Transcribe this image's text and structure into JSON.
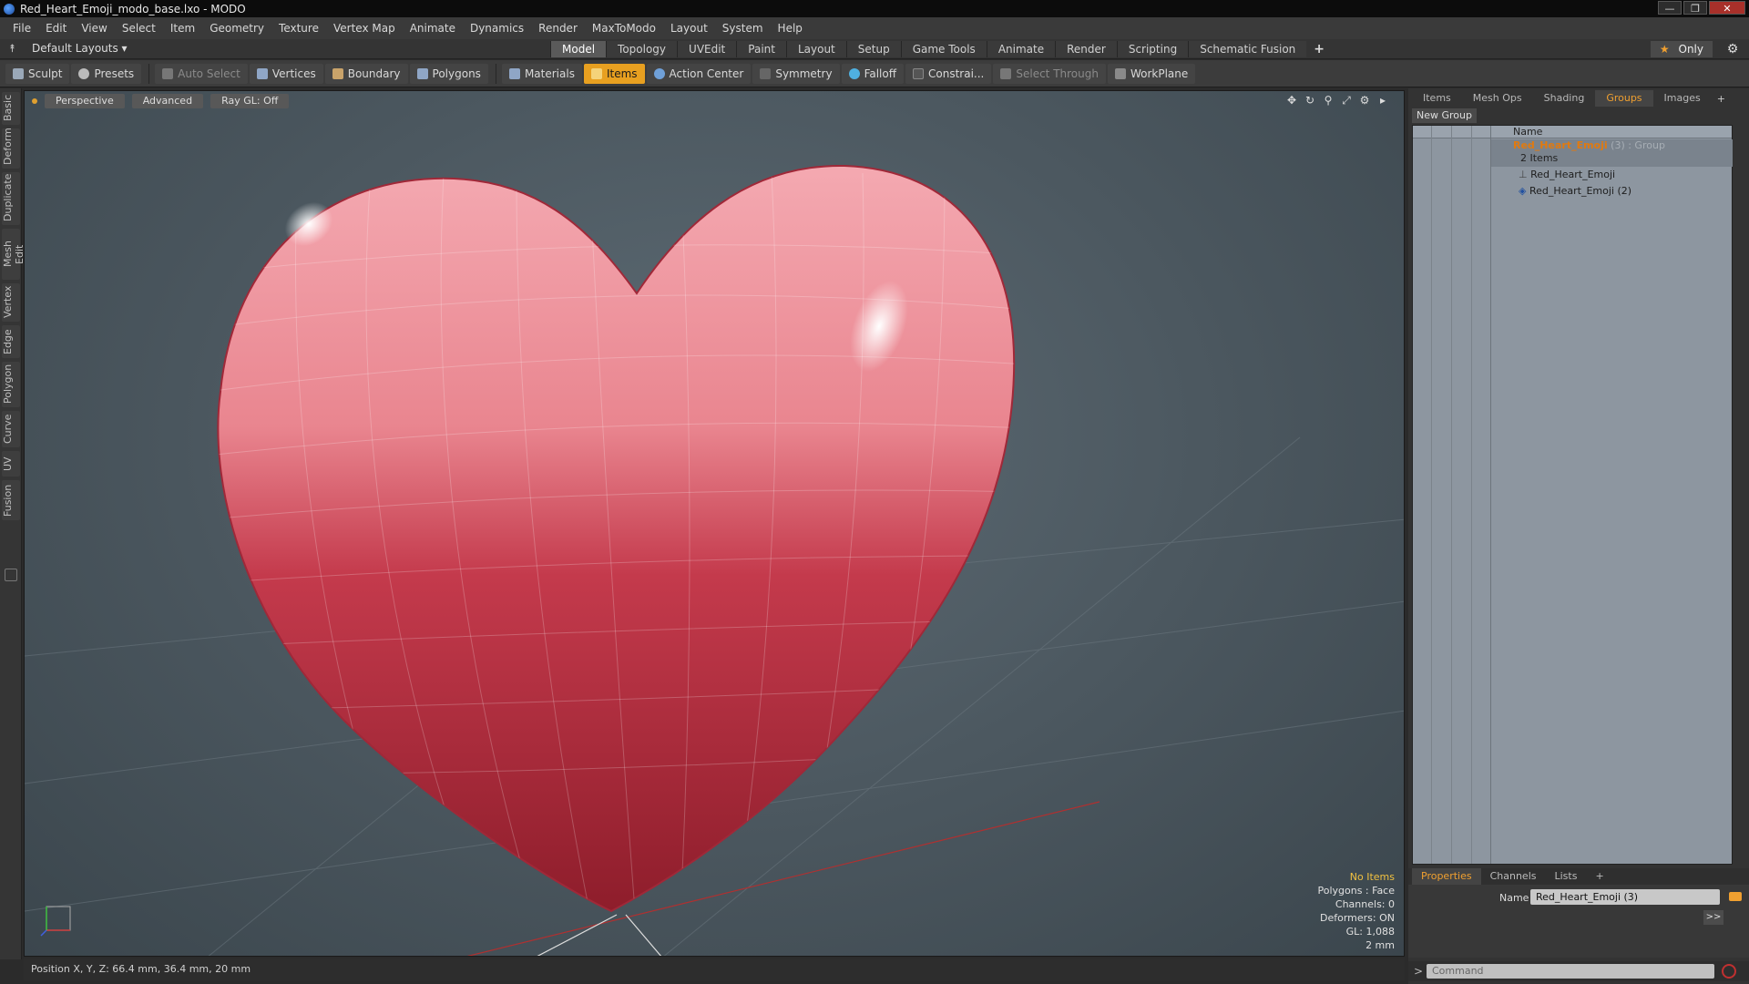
{
  "window": {
    "title": "Red_Heart_Emoji_modo_base.lxo - MODO",
    "controls": [
      "—",
      "❐",
      "✕"
    ]
  },
  "menubar": {
    "items": [
      "File",
      "Edit",
      "View",
      "Select",
      "Item",
      "Geometry",
      "Texture",
      "Vertex Map",
      "Animate",
      "Dynamics",
      "Render",
      "MaxToModo",
      "Layout",
      "System",
      "Help"
    ]
  },
  "layoutbar": {
    "layout_label": "Default Layouts ▾",
    "tabs": [
      "Model",
      "Topology",
      "UVEdit",
      "Paint",
      "Layout",
      "Setup",
      "Game Tools",
      "Animate",
      "Render",
      "Scripting",
      "Schematic Fusion"
    ],
    "active_tab": "Model",
    "plus": "+",
    "only_label": "Only",
    "only_icon": "star-icon"
  },
  "toolbar": {
    "sculpt": "Sculpt",
    "presets": "Presets",
    "auto_select": "Auto Select",
    "vertices": "Vertices",
    "boundary": "Boundary",
    "polygons": "Polygons",
    "materials": "Materials",
    "items": "Items",
    "action_center": "Action Center",
    "symmetry": "Symmetry",
    "falloff": "Falloff",
    "constrain": "Constrai...",
    "select_through": "Select Through",
    "workplane": "WorkPlane"
  },
  "left_tabs": [
    "Basic",
    "Deform",
    "Duplicate",
    "Mesh Edit",
    "Vertex",
    "Edge",
    "Polygon",
    "Curve",
    "UV",
    "Fusion"
  ],
  "viewport": {
    "view_mode": "Perspective",
    "shading": "Advanced",
    "raygl": "Ray GL: Off",
    "info": {
      "no_items": "No Items",
      "polygons": "Polygons : Face",
      "channels": "Channels: 0",
      "deformers": "Deformers: ON",
      "gl": "GL: 1,088",
      "unit": "2 mm"
    },
    "heart_color": "#c43a4c",
    "background_color": "#55626a"
  },
  "statusbar": {
    "position": "Position X, Y, Z:  66.4 mm, 36.4 mm, 20 mm"
  },
  "right_panel": {
    "tabs": [
      "Items",
      "Mesh Ops",
      "Shading",
      "Groups",
      "Images"
    ],
    "active_tab": "Groups",
    "new_group": "New Group",
    "column_name": "Name",
    "group": {
      "name": "Red_Heart_Emoji",
      "suffix": "(3) : Group",
      "count": "2 Items",
      "children": [
        "Red_Heart_Emoji",
        "Red_Heart_Emoji (2)"
      ]
    }
  },
  "properties": {
    "tabs": [
      "Properties",
      "Channels",
      "Lists"
    ],
    "active_tab": "Properties",
    "name_label": "Name",
    "name_value": "Red_Heart_Emoji (3)",
    "more": ">>"
  },
  "command": {
    "prompt": ">",
    "placeholder": "Command"
  }
}
